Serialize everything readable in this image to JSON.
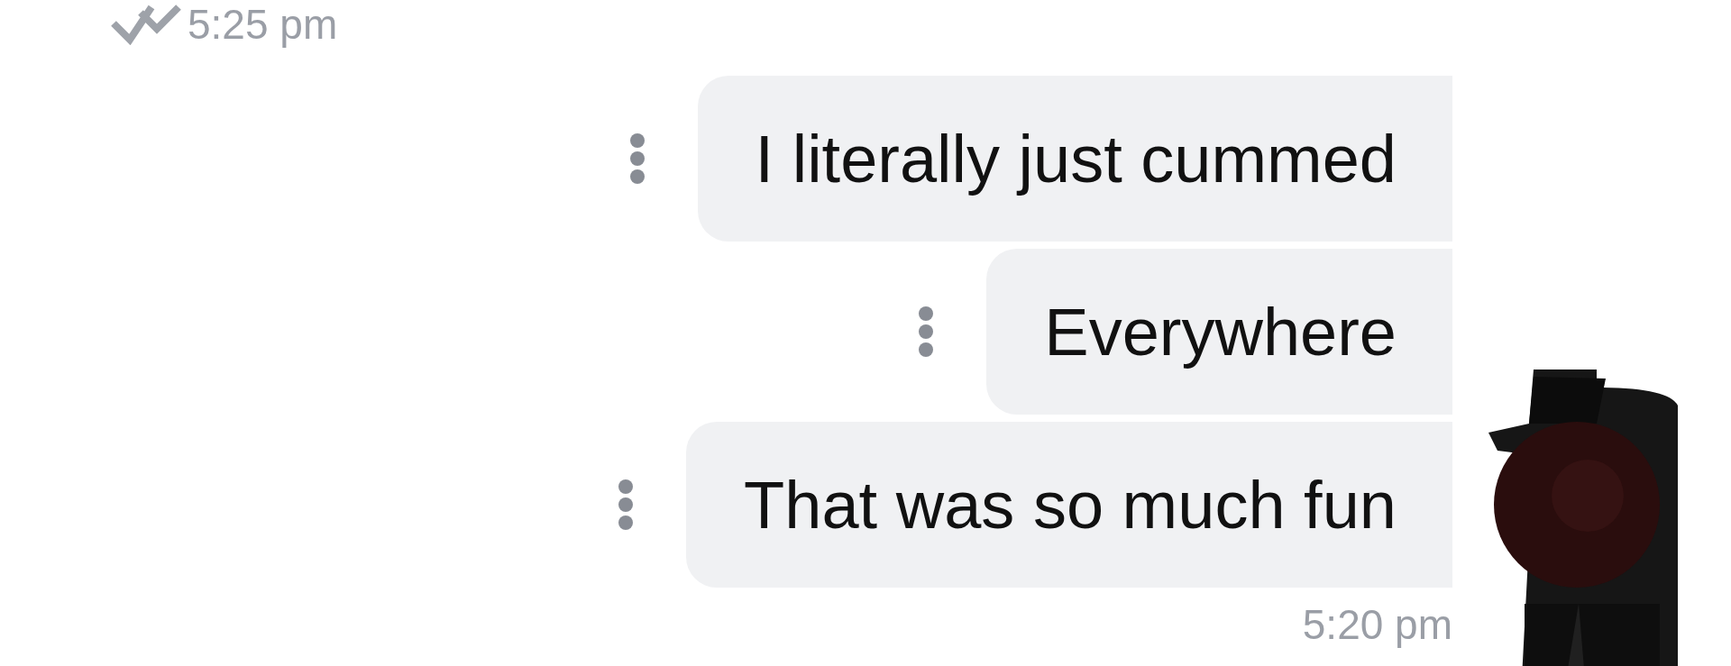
{
  "sent_meta": {
    "time": "5:25 pm",
    "read": true
  },
  "messages": [
    {
      "text": "I literally just cummed"
    },
    {
      "text": "Everywhere"
    },
    {
      "text": "That was so much fun"
    }
  ],
  "received_meta": {
    "time": "5:20 pm"
  }
}
